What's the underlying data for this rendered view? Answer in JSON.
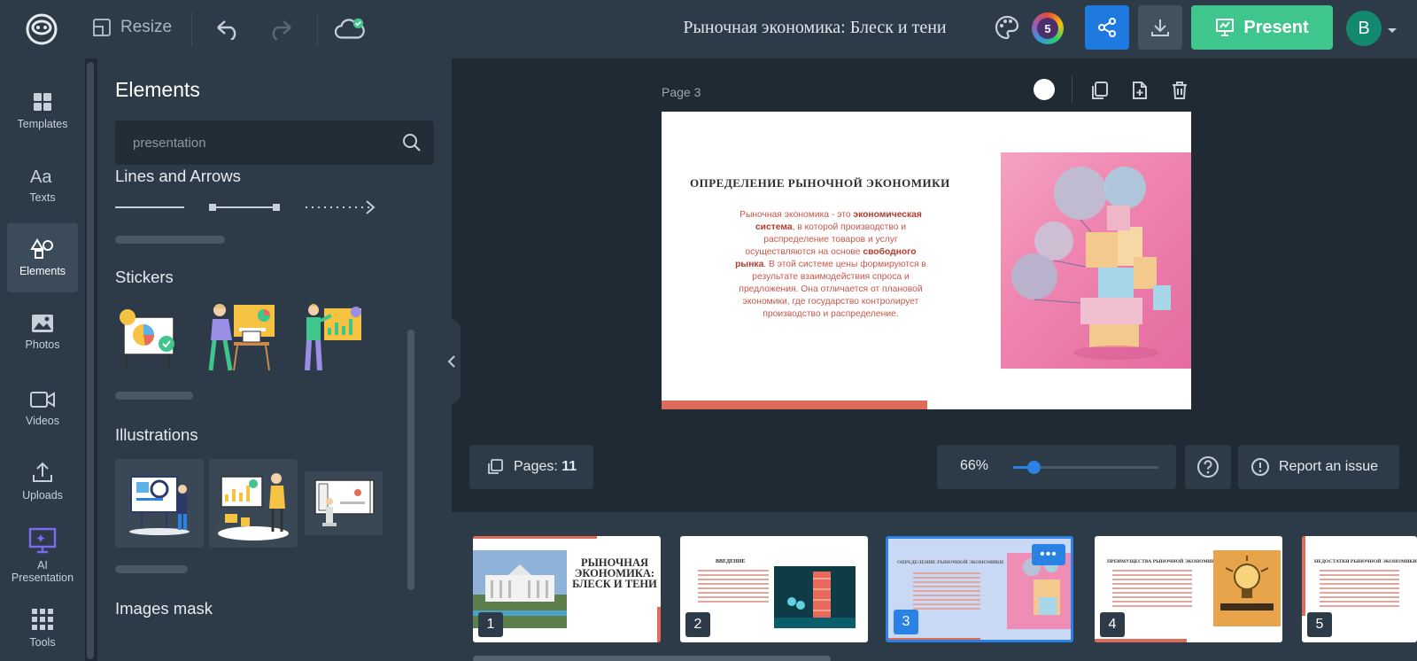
{
  "topbar": {
    "resize_label": "Resize",
    "doc_title": "Рыночная экономика: Блеск и тени",
    "collaborators_count": "5",
    "present_label": "Present",
    "avatar_initial": "B"
  },
  "rail": {
    "items": [
      {
        "label": "Templates",
        "icon": "templates-icon"
      },
      {
        "label": "Texts",
        "icon": "texts-icon"
      },
      {
        "label": "Elements",
        "icon": "elements-icon",
        "active": true
      },
      {
        "label": "Photos",
        "icon": "photos-icon"
      },
      {
        "label": "Videos",
        "icon": "videos-icon"
      },
      {
        "label": "Uploads",
        "icon": "uploads-icon"
      },
      {
        "label": "AI Presentation",
        "icon": "ai-presentation-icon"
      },
      {
        "label": "Tools",
        "icon": "tools-icon"
      }
    ]
  },
  "panel": {
    "title": "Elements",
    "search_value": "presentation",
    "sections": {
      "lines": "Lines and Arrows",
      "stickers": "Stickers",
      "illustrations": "Illustrations",
      "masks": "Images mask"
    }
  },
  "canvas": {
    "page_label": "Page 3",
    "slide": {
      "title": "ОПРЕДЕЛЕНИЕ РЫНОЧНОЙ ЭКОНОМИКИ",
      "body_1": "Рыночная экономика - это ",
      "body_bold_1": "экономическая система",
      "body_2": ", в которой производство и распределение товаров и услуг осуществляются на основе ",
      "body_bold_2": "свободного рынка",
      "body_3": ". В этой системе цены формируются в результате взаимодействия спроса и предложения. Она отличается от плановой экономики, где государство контролирует производство и распределение."
    }
  },
  "bottom": {
    "pages_label": "Pages:",
    "pages_count": "11",
    "zoom_label": "66%",
    "zoom_fraction": 0.14,
    "report_label": "Report an issue"
  },
  "filmstrip": {
    "slides": [
      {
        "num": "1",
        "title": "РЫНОЧНАЯ ЭКОНОМИКА: БЛЕСК И ТЕНИ"
      },
      {
        "num": "2",
        "title": "ВВЕДЕНИЕ"
      },
      {
        "num": "3",
        "title": "ОПРЕДЕЛЕНИЕ РЫНОЧНОЙ ЭКОНОМИКИ",
        "active": true
      },
      {
        "num": "4",
        "title": "ПРЕИМУЩЕСТВА РЫНОЧНОЙ ЭКОНОМИКИ"
      },
      {
        "num": "5",
        "title": "НЕДОСТАТКИ РЫНОЧНОЙ ЭКОНОМИКИ"
      }
    ],
    "more_label": "•••"
  },
  "colors": {
    "accent_blue": "#1f7ae0",
    "present_green": "#3fc68c",
    "slide_accent": "#df6c5a",
    "panel_bg": "#2d3b48",
    "workspace_bg": "#1f2a35"
  }
}
